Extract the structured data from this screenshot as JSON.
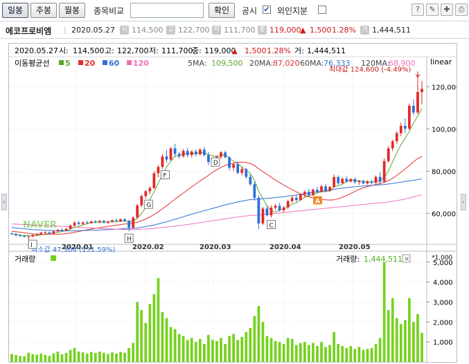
{
  "toolbar": {
    "daily": "일봉",
    "weekly": "주봉",
    "monthly": "월봉",
    "compare_label": "종목비교",
    "compare_value": "",
    "confirm": "확인",
    "disclosure": "공시",
    "disclosure_checked": "✔",
    "foreign": "외인지분",
    "foreign_checked": ""
  },
  "info": {
    "name": "에코프로비엠",
    "date": "2020.05.27",
    "open_badge": "시",
    "open": "114,500",
    "high_badge": "고",
    "high": "122,700",
    "low_badge": "저",
    "low": "111,700",
    "close_badge": "종",
    "close": "119,000",
    "arrow": "▲",
    "change": "1,500",
    "change_pct": "1.28%",
    "volume_badge": "거",
    "volume": "1,444,511"
  },
  "chart_header": {
    "date": "2020.05.27",
    "open_label": "시:",
    "open": "114,500",
    "high_label": "고:",
    "high": "122,700",
    "low_label": "저:",
    "low": "111,700",
    "close_label": "종:",
    "close": "119,000",
    "arrow": "▲",
    "change": "1,500",
    "change_pct": "1.28%",
    "volume_label": "거:",
    "volume": "1,444,511"
  },
  "ma_legend": {
    "title": "이동평균선",
    "items": [
      {
        "label": "5",
        "color": "#5aa52a"
      },
      {
        "label": "20",
        "color": "#e03030"
      },
      {
        "label": "60",
        "color": "#2f6fd6"
      },
      {
        "label": "120",
        "color": "#f070b8"
      }
    ],
    "values": [
      {
        "label": "5MA:",
        "value": "109,500",
        "color": "#5aa52a"
      },
      {
        "label": "20MA:",
        "value": "87,020",
        "color": "#e03030"
      },
      {
        "label": "60MA:",
        "value": "76,333",
        "color": "#2f6fd6"
      },
      {
        "label": "120MA:",
        "value": "68,900",
        "color": "#f070b8"
      }
    ],
    "scale": "linear"
  },
  "annotations": {
    "max_label": "최대값 124,600 (-4.49%)",
    "min_label": "최소값 47,300 (151.59%)",
    "markers": [
      "H",
      "G",
      "F",
      "D",
      "C",
      "I"
    ],
    "alert_marker": "A",
    "watermark": "NAVER"
  },
  "volume_panel": {
    "title": "거래량",
    "value_label": "거래량:",
    "value": "1,444,511",
    "unit": "*1,000",
    "close_symbol": "×",
    "color": "#76d11f"
  },
  "chart_data": {
    "type": "candlestick",
    "x_ticks": [
      "2020.01",
      "2020.02",
      "2020.03",
      "2020.04",
      "2020.05"
    ],
    "price_ticks": [
      "60,000",
      "80,000",
      "100,000",
      "120,000"
    ],
    "price_ylim": [
      46000,
      128000
    ],
    "volume_ticks": [
      "1,000",
      "2,000",
      "3,000",
      "4,000",
      "5,000"
    ],
    "volume_ylim": [
      0,
      5200
    ],
    "ohlc": [
      [
        50500,
        51000,
        49800,
        50200
      ],
      [
        50200,
        50800,
        49200,
        49600
      ],
      [
        49600,
        50200,
        48800,
        49300
      ],
      [
        49300,
        49900,
        48500,
        48900
      ],
      [
        48900,
        49600,
        47300,
        49100
      ],
      [
        49100,
        50000,
        48600,
        49800
      ],
      [
        49800,
        50600,
        49200,
        50300
      ],
      [
        50300,
        51200,
        49900,
        50900
      ],
      [
        50900,
        51600,
        50200,
        51000
      ],
      [
        51000,
        51400,
        50100,
        50400
      ],
      [
        50400,
        51800,
        50200,
        51500
      ],
      [
        51500,
        52600,
        51000,
        52200
      ],
      [
        52200,
        52900,
        51500,
        51900
      ],
      [
        51900,
        53000,
        51400,
        52700
      ],
      [
        52700,
        54800,
        52300,
        54200
      ],
      [
        54200,
        56200,
        53700,
        55600
      ],
      [
        55600,
        56500,
        54500,
        55000
      ],
      [
        55000,
        56100,
        54300,
        55700
      ],
      [
        55700,
        56500,
        55000,
        55400
      ],
      [
        55400,
        56600,
        55100,
        56200
      ],
      [
        56200,
        56900,
        55300,
        55800
      ],
      [
        55800,
        57000,
        55200,
        56400
      ],
      [
        56400,
        56900,
        55200,
        55600
      ],
      [
        55600,
        56600,
        55000,
        56100
      ],
      [
        56100,
        57200,
        55600,
        56700
      ],
      [
        56700,
        57500,
        55900,
        56300
      ],
      [
        56300,
        57600,
        55800,
        57200
      ],
      [
        57200,
        57900,
        56000,
        56500
      ],
      [
        56500,
        57000,
        51500,
        53200
      ],
      [
        53200,
        58500,
        52800,
        58000
      ],
      [
        58000,
        64500,
        57500,
        63800
      ],
      [
        63800,
        69000,
        63000,
        68200
      ],
      [
        68200,
        71000,
        67000,
        70500
      ],
      [
        70500,
        73000,
        69000,
        72000
      ],
      [
        72000,
        80000,
        71500,
        79000
      ],
      [
        79000,
        83000,
        77000,
        82000
      ],
      [
        82000,
        88000,
        81000,
        87000
      ],
      [
        87000,
        90000,
        84000,
        85500
      ],
      [
        85500,
        91500,
        85000,
        90800
      ],
      [
        90800,
        93000,
        87000,
        88200
      ],
      [
        88200,
        89000,
        86000,
        87000
      ],
      [
        87000,
        90500,
        86500,
        89600
      ],
      [
        89600,
        91000,
        86500,
        87600
      ],
      [
        87600,
        90000,
        86500,
        89300
      ],
      [
        89300,
        90200,
        87000,
        88000
      ],
      [
        88000,
        90800,
        87500,
        90200
      ],
      [
        90200,
        91500,
        87000,
        87600
      ],
      [
        87600,
        89000,
        83000,
        84300
      ],
      [
        84300,
        86000,
        82500,
        85200
      ],
      [
        85200,
        87500,
        84500,
        86800
      ],
      [
        86800,
        89500,
        86000,
        88900
      ],
      [
        88900,
        89800,
        86000,
        86600
      ],
      [
        86600,
        87200,
        80500,
        81600
      ],
      [
        81600,
        84000,
        80000,
        83300
      ],
      [
        83300,
        84500,
        78500,
        79200
      ],
      [
        79200,
        82000,
        78000,
        81000
      ],
      [
        81000,
        81500,
        76500,
        77300
      ],
      [
        77300,
        78500,
        73000,
        73800
      ],
      [
        73800,
        75000,
        66000,
        67400
      ],
      [
        67400,
        68500,
        52500,
        55200
      ],
      [
        55200,
        63000,
        54500,
        62300
      ],
      [
        62300,
        63500,
        58500,
        59100
      ],
      [
        59100,
        63800,
        58000,
        62700
      ],
      [
        62700,
        64500,
        61500,
        63600
      ],
      [
        63600,
        65000,
        60800,
        61500
      ],
      [
        61500,
        63500,
        60200,
        62800
      ],
      [
        62800,
        66500,
        62000,
        65800
      ],
      [
        65800,
        68500,
        65000,
        67400
      ],
      [
        67400,
        69000,
        65500,
        66300
      ],
      [
        66300,
        69500,
        66000,
        68900
      ],
      [
        68900,
        71000,
        67500,
        70200
      ],
      [
        70200,
        71500,
        68000,
        68600
      ],
      [
        68600,
        71800,
        68200,
        71200
      ],
      [
        71200,
        72500,
        69500,
        70100
      ],
      [
        70100,
        73500,
        69800,
        72800
      ],
      [
        72800,
        74000,
        70000,
        70600
      ],
      [
        70600,
        73000,
        70200,
        72500
      ],
      [
        72500,
        78500,
        72000,
        77200
      ],
      [
        77200,
        78000,
        73500,
        74300
      ],
      [
        74300,
        77000,
        73800,
        76400
      ],
      [
        76400,
        77600,
        74500,
        75100
      ],
      [
        75100,
        76800,
        74600,
        76200
      ],
      [
        76200,
        77000,
        74000,
        74800
      ],
      [
        74800,
        75800,
        73500,
        75300
      ],
      [
        75300,
        76000,
        73800,
        74200
      ],
      [
        74200,
        75800,
        73600,
        75100
      ],
      [
        75100,
        76000,
        73800,
        74500
      ],
      [
        74500,
        78000,
        74000,
        77300
      ],
      [
        77300,
        79500,
        73500,
        75000
      ],
      [
        75000,
        86000,
        74500,
        84800
      ],
      [
        84800,
        92000,
        84000,
        90800
      ],
      [
        90800,
        95000,
        89500,
        94200
      ],
      [
        94200,
        99000,
        93000,
        98000
      ],
      [
        98000,
        103000,
        96500,
        101500
      ],
      [
        101500,
        105000,
        98000,
        100200
      ],
      [
        100200,
        112000,
        99500,
        111000
      ],
      [
        111000,
        114000,
        106500,
        107800
      ],
      [
        107800,
        124600,
        107000,
        117500
      ],
      [
        117500,
        122700,
        111700,
        119000
      ]
    ],
    "volume": [
      400,
      350,
      300,
      280,
      460,
      380,
      360,
      420,
      350,
      300,
      420,
      520,
      380,
      450,
      600,
      700,
      520,
      480,
      420,
      500,
      450,
      520,
      460,
      400,
      480,
      420,
      500,
      460,
      700,
      950,
      3000,
      2600,
      1950,
      2900,
      3400,
      4200,
      2500,
      2200,
      1750,
      1650,
      1400,
      1300,
      1100,
      1200,
      1000,
      1150,
      900,
      1350,
      1100,
      1050,
      1200,
      900,
      1300,
      1400,
      1100,
      1250,
      1500,
      1700,
      2300,
      2800,
      2000,
      1300,
      1200,
      1050,
      1000,
      900,
      1200,
      1150,
      850,
      950,
      1000,
      850,
      950,
      800,
      1000,
      750,
      850,
      1500,
      900,
      800,
      700,
      800,
      650,
      750,
      600,
      650,
      700,
      900,
      1200,
      5000,
      2600,
      3200,
      2200,
      1900,
      2100,
      3200,
      2000,
      2400,
      1450
    ],
    "ma": {
      "5": [
        50300,
        49900,
        49600,
        49400,
        49400,
        49400,
        49500,
        49800,
        50200,
        50500,
        50700,
        51000,
        51400,
        51800,
        52500,
        53200,
        53900,
        54500,
        55100,
        55600,
        55800,
        55900,
        55900,
        55900,
        56000,
        56100,
        56300,
        56400,
        55900,
        56200,
        57700,
        59900,
        62800,
        66600,
        70200,
        74300,
        78400,
        82000,
        84700,
        86900,
        87800,
        88100,
        88400,
        88400,
        88300,
        88800,
        88700,
        87900,
        87300,
        86900,
        87500,
        87800,
        86000,
        84700,
        83500,
        81900,
        80400,
        78900,
        75600,
        70400,
        67000,
        63600,
        61300,
        60600,
        61600,
        62000,
        63200,
        64400,
        65000,
        66300,
        67700,
        68300,
        68900,
        69600,
        70400,
        70300,
        70700,
        72500,
        73100,
        73800,
        75100,
        75800,
        75800,
        75400,
        75100,
        75000,
        74800,
        75300,
        75600,
        77000,
        80100,
        84400,
        88700,
        92600,
        95600,
        98900,
        102700,
        106200,
        109500
      ],
      "20": [
        51500,
        51300,
        51100,
        50800,
        50500,
        50300,
        50100,
        50000,
        50000,
        50000,
        50000,
        50100,
        50200,
        50400,
        50700,
        51000,
        51400,
        51800,
        52200,
        52600,
        52900,
        53200,
        53500,
        53800,
        54100,
        54400,
        54700,
        55000,
        55100,
        55300,
        55800,
        56500,
        57300,
        58300,
        59400,
        60700,
        62200,
        63600,
        65200,
        66700,
        68200,
        69600,
        71100,
        72600,
        74000,
        75400,
        76700,
        78000,
        79500,
        80700,
        81800,
        82700,
        83400,
        83800,
        84200,
        84300,
        84100,
        83600,
        82700,
        81100,
        79800,
        78500,
        77100,
        75800,
        74600,
        73400,
        72300,
        71300,
        70200,
        69200,
        68600,
        67800,
        67300,
        66900,
        66500,
        66400,
        66300,
        66400,
        66900,
        67600,
        68500,
        69400,
        70400,
        71400,
        72100,
        72700,
        73200,
        73700,
        74100,
        74700,
        75500,
        76600,
        78000,
        79500,
        81100,
        82700,
        84400,
        86000,
        87020
      ],
      "60": [
        53300,
        53100,
        52900,
        52700,
        52500,
        52300,
        52200,
        52100,
        52000,
        51900,
        51800,
        51800,
        51700,
        51700,
        51700,
        51700,
        51800,
        51800,
        51900,
        52000,
        52000,
        52100,
        52200,
        52300,
        52400,
        52500,
        52600,
        52800,
        52800,
        52900,
        53100,
        53400,
        53700,
        54100,
        54500,
        55000,
        55500,
        56000,
        56600,
        57200,
        57800,
        58400,
        59000,
        59600,
        60200,
        60700,
        61300,
        61800,
        62400,
        62900,
        63500,
        64000,
        64500,
        65000,
        65400,
        65800,
        66200,
        66500,
        66700,
        66800,
        67000,
        67100,
        67300,
        67500,
        67700,
        67900,
        68200,
        68400,
        68700,
        69000,
        69300,
        69600,
        69900,
        70200,
        70500,
        70800,
        71100,
        71400,
        71700,
        72000,
        72200,
        72400,
        72600,
        72800,
        73000,
        73100,
        73300,
        73400,
        73500,
        73700,
        73900,
        74200,
        74500,
        74800,
        75100,
        75400,
        75700,
        76000,
        76333
      ],
      "120": [
        55000,
        54900,
        54800,
        54700,
        54600,
        54500,
        54400,
        54300,
        54200,
        54100,
        54000,
        53900,
        53800,
        53700,
        53600,
        53500,
        53400,
        53300,
        53200,
        53100,
        53000,
        52900,
        52800,
        52700,
        52600,
        52500,
        52400,
        52400,
        52300,
        52300,
        52400,
        52500,
        52600,
        52700,
        52900,
        53100,
        53300,
        53500,
        53700,
        53900,
        54200,
        54400,
        54700,
        55000,
        55300,
        55600,
        55900,
        56200,
        56500,
        56800,
        57100,
        57400,
        57700,
        58000,
        58300,
        58600,
        58800,
        59000,
        59100,
        59200,
        59400,
        59600,
        59800,
        60000,
        60200,
        60400,
        60600,
        60800,
        61000,
        61200,
        61400,
        61600,
        61800,
        62000,
        62200,
        62400,
        62600,
        62800,
        63000,
        63200,
        63400,
        63600,
        63800,
        64000,
        64200,
        64400,
        64600,
        64800,
        65000,
        65200,
        65400,
        65700,
        66000,
        66400,
        66800,
        67300,
        67800,
        68300,
        68900
      ]
    }
  }
}
